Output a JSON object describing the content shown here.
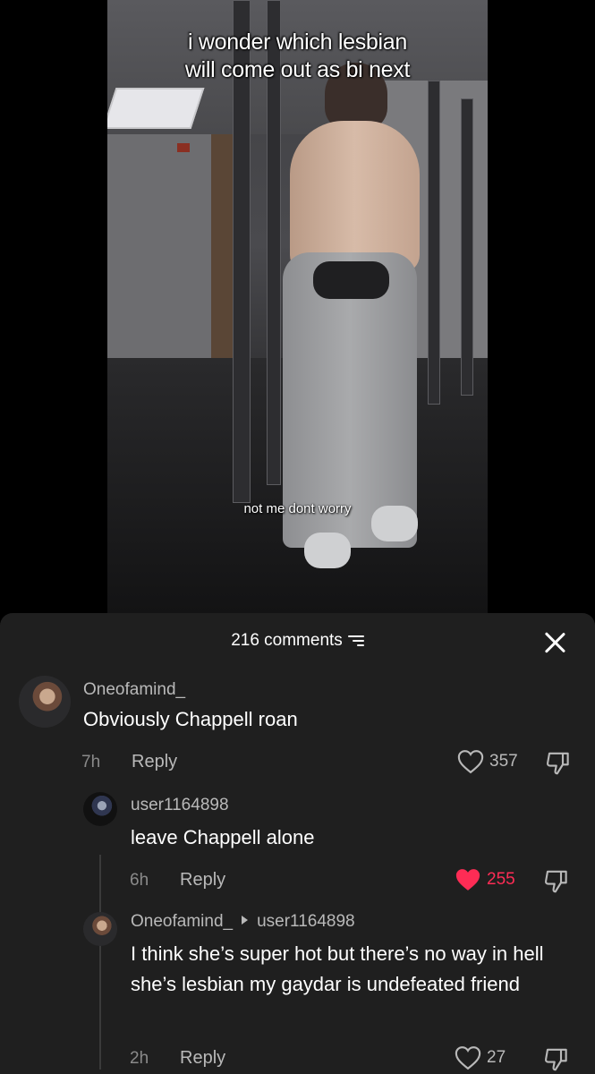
{
  "video": {
    "caption_top": "i wonder which lesbian\nwill come out as bi next",
    "caption_mid": "not me dont worry"
  },
  "comments_sheet": {
    "count_label": "216 comments",
    "filter_icon": "filter-icon",
    "close_icon": "close-icon",
    "comments": [
      {
        "username": "Oneofamind_",
        "text": "Obviously Chappell roan",
        "time": "7h",
        "reply_label": "Reply",
        "likes": "357",
        "liked": false
      },
      {
        "username": "user1164898",
        "text": "leave Chappell alone",
        "time": "6h",
        "reply_label": "Reply",
        "likes": "255",
        "liked": true
      },
      {
        "username": "Oneofamind_",
        "reply_to": "user1164898",
        "text": "I think she’s super hot but there’s no way in hell she’s lesbian my gaydar is undefeated friend",
        "time": "2h",
        "reply_label": "Reply",
        "likes": "27",
        "liked": false
      }
    ]
  },
  "colors": {
    "sheet_bg": "#1f1f1f",
    "like_active": "#fe2c55"
  }
}
